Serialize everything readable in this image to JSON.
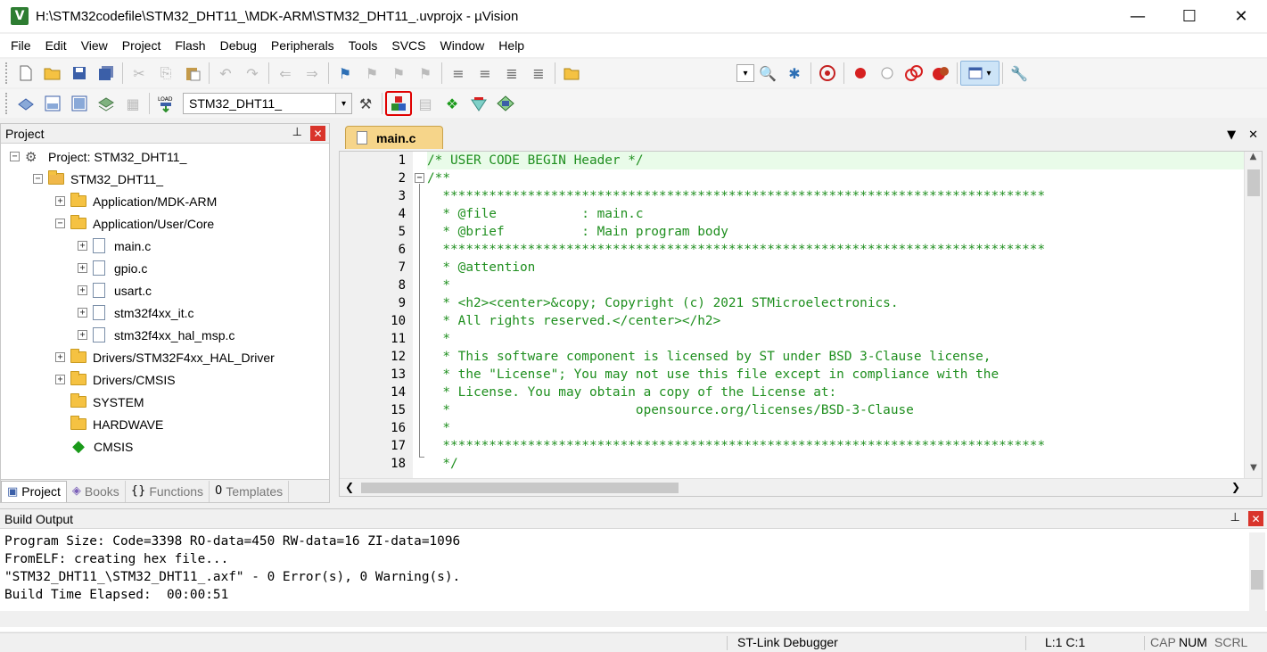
{
  "window": {
    "title": "H:\\STM32codefile\\STM32_DHT11_\\MDK-ARM\\STM32_DHT11_.uvprojx - µVision",
    "app_icon_letter": "V",
    "minimize": "—",
    "maximize": "☐",
    "close": "✕"
  },
  "menu": [
    "File",
    "Edit",
    "View",
    "Project",
    "Flash",
    "Debug",
    "Peripherals",
    "Tools",
    "SVCS",
    "Window",
    "Help"
  ],
  "toolbar2": {
    "target": "STM32_DHT11_"
  },
  "project_panel": {
    "title": "Project",
    "pin": "📌",
    "close": "✕",
    "tree": [
      {
        "label": "Project: STM32_DHT11_",
        "toggle": "−",
        "kind": "project"
      },
      {
        "label": "STM32_DHT11_",
        "toggle": "−",
        "kind": "target"
      },
      {
        "label": "Application/MDK-ARM",
        "toggle": "+",
        "kind": "folder"
      },
      {
        "label": "Application/User/Core",
        "toggle": "−",
        "kind": "folder"
      },
      {
        "label": "main.c",
        "toggle": "+",
        "kind": "file"
      },
      {
        "label": "gpio.c",
        "toggle": "+",
        "kind": "file"
      },
      {
        "label": "usart.c",
        "toggle": "+",
        "kind": "file"
      },
      {
        "label": "stm32f4xx_it.c",
        "toggle": "+",
        "kind": "file"
      },
      {
        "label": "stm32f4xx_hal_msp.c",
        "toggle": "+",
        "kind": "file"
      },
      {
        "label": "Drivers/STM32F4xx_HAL_Driver",
        "toggle": "+",
        "kind": "folder"
      },
      {
        "label": "Drivers/CMSIS",
        "toggle": "+",
        "kind": "folder"
      },
      {
        "label": "SYSTEM",
        "toggle": "",
        "kind": "folder"
      },
      {
        "label": "HARDWAVE",
        "toggle": "",
        "kind": "folder"
      },
      {
        "label": "CMSIS",
        "toggle": "",
        "kind": "cmsis"
      }
    ],
    "tabs": [
      "Project",
      "Books",
      "Functions",
      "Templates"
    ]
  },
  "editor": {
    "tab": "main.c",
    "lines": [
      {
        "n": "1",
        "text": "/* USER CODE BEGIN Header */"
      },
      {
        "n": "2",
        "text": "/**"
      },
      {
        "n": "3",
        "text": "  ******************************************************************************"
      },
      {
        "n": "4",
        "text": "  * @file           : main.c"
      },
      {
        "n": "5",
        "text": "  * @brief          : Main program body"
      },
      {
        "n": "6",
        "text": "  ******************************************************************************"
      },
      {
        "n": "7",
        "text": "  * @attention"
      },
      {
        "n": "8",
        "text": "  *"
      },
      {
        "n": "9",
        "text": "  * <h2><center>&copy; Copyright (c) 2021 STMicroelectronics."
      },
      {
        "n": "10",
        "text": "  * All rights reserved.</center></h2>"
      },
      {
        "n": "11",
        "text": "  *"
      },
      {
        "n": "12",
        "text": "  * This software component is licensed by ST under BSD 3-Clause license,"
      },
      {
        "n": "13",
        "text": "  * the \"License\"; You may not use this file except in compliance with the"
      },
      {
        "n": "14",
        "text": "  * License. You may obtain a copy of the License at:"
      },
      {
        "n": "15",
        "text": "  *                        opensource.org/licenses/BSD-3-Clause"
      },
      {
        "n": "16",
        "text": "  *"
      },
      {
        "n": "17",
        "text": "  ******************************************************************************"
      },
      {
        "n": "18",
        "text": "  */"
      }
    ]
  },
  "build_output": {
    "title": "Build Output",
    "lines": [
      "Program Size: Code=3398 RO-data=450 RW-data=16 ZI-data=1096",
      "FromELF: creating hex file...",
      "\"STM32_DHT11_\\STM32_DHT11_.axf\" - 0 Error(s), 0 Warning(s).",
      "Build Time Elapsed:  00:00:51"
    ]
  },
  "status": {
    "debugger": "ST-Link Debugger",
    "position": "L:1 C:1",
    "cap": "CAP",
    "num": "NUM",
    "scrl": "SCRL"
  },
  "colors": {
    "comment_green": "#1f8f1f",
    "tab_orange": "#f6d58a",
    "highlight_red": "#e00000"
  }
}
